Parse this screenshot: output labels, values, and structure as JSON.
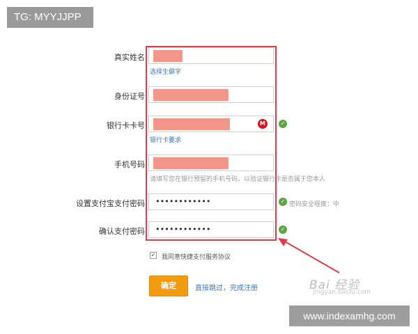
{
  "badge": {
    "text": "TG: MYYJJPP"
  },
  "form": {
    "name": {
      "label": "真实姓名",
      "link": "选择生僻字"
    },
    "id": {
      "label": "身份证号"
    },
    "card": {
      "label": "银行卡卡号",
      "link": "银行卡要求",
      "bank_logo": "cmb-bank-icon"
    },
    "phone": {
      "label": "手机号码",
      "hint": "请填写您在银行预留的手机号码，以验证银行卡是否属于您本人"
    },
    "pay_password": {
      "label": "设置支付宝支付密码",
      "value": "••••••••••••",
      "strength": "密码安全程度：中"
    },
    "confirm_password": {
      "label": "确认支付密码",
      "value": "••••••••••••"
    }
  },
  "agreement": {
    "checked": true,
    "text": "我同意快捷支付服务协议"
  },
  "actions": {
    "confirm_label": "确定",
    "skip_label": "直接跳过，完成注册"
  },
  "watermarks": {
    "baidu": "Bai 经验",
    "baidu_sub": "jingyan.baidu.com",
    "site": "www.indexamhg.com"
  },
  "colors": {
    "highlight": "#e03b4a",
    "confirm": "#f39c12",
    "link": "#3a76c4",
    "check": "#5aa83e",
    "redaction": "#f4958a"
  }
}
